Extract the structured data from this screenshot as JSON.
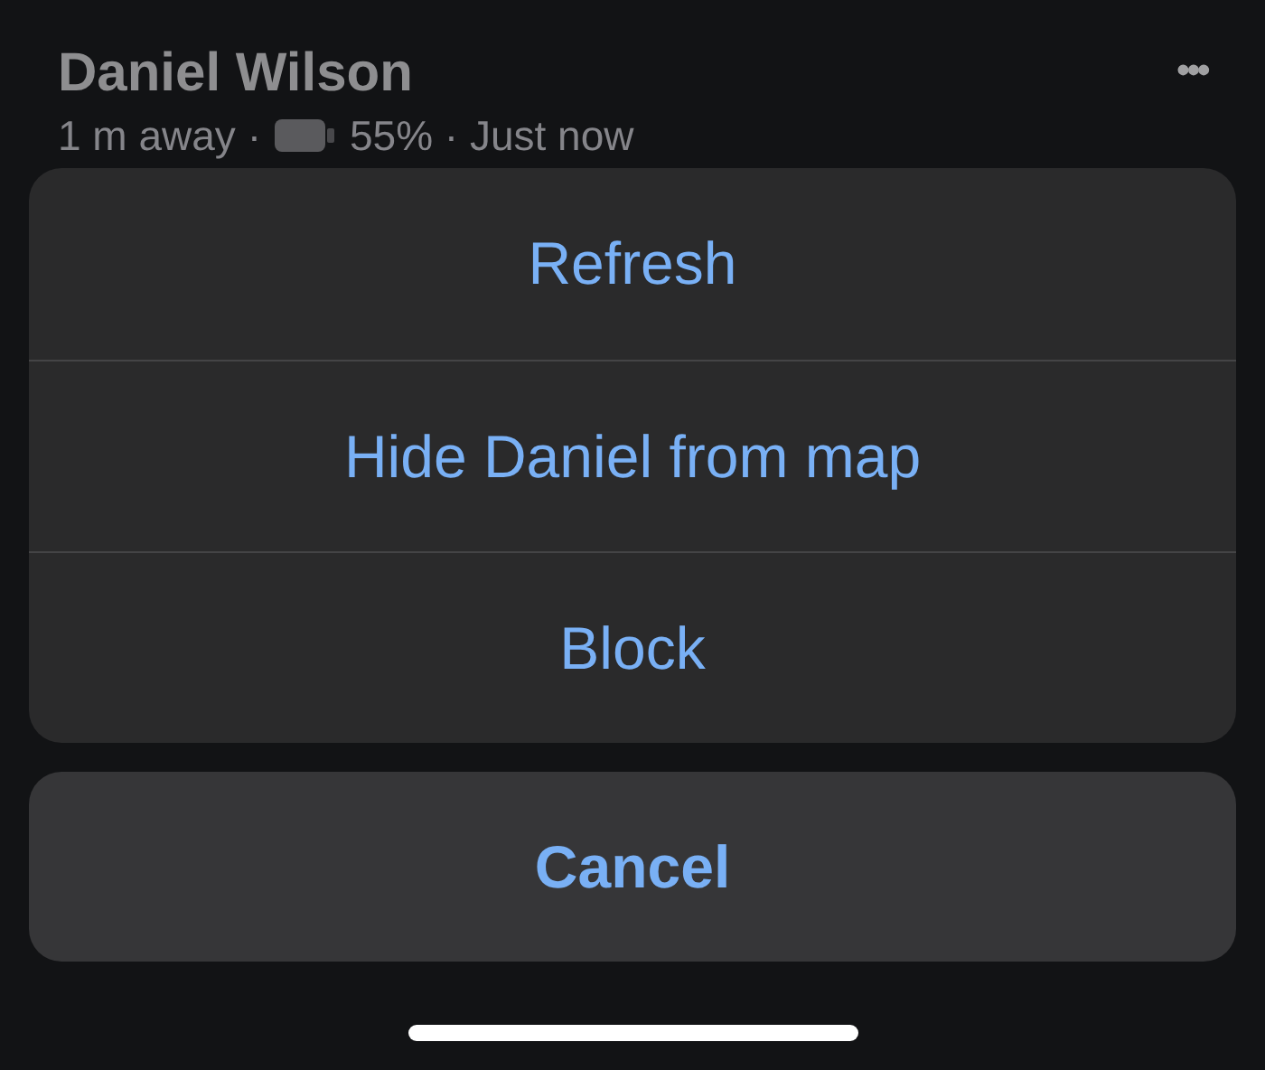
{
  "contact": {
    "name": "Daniel Wilson",
    "distance": "1 m away ·",
    "battery": "55% · Just now"
  },
  "menu_icon": "•••",
  "action_sheet": {
    "actions": [
      {
        "label": "Refresh"
      },
      {
        "label": "Hide Daniel from map"
      },
      {
        "label": "Block"
      }
    ],
    "cancel": "Cancel"
  }
}
